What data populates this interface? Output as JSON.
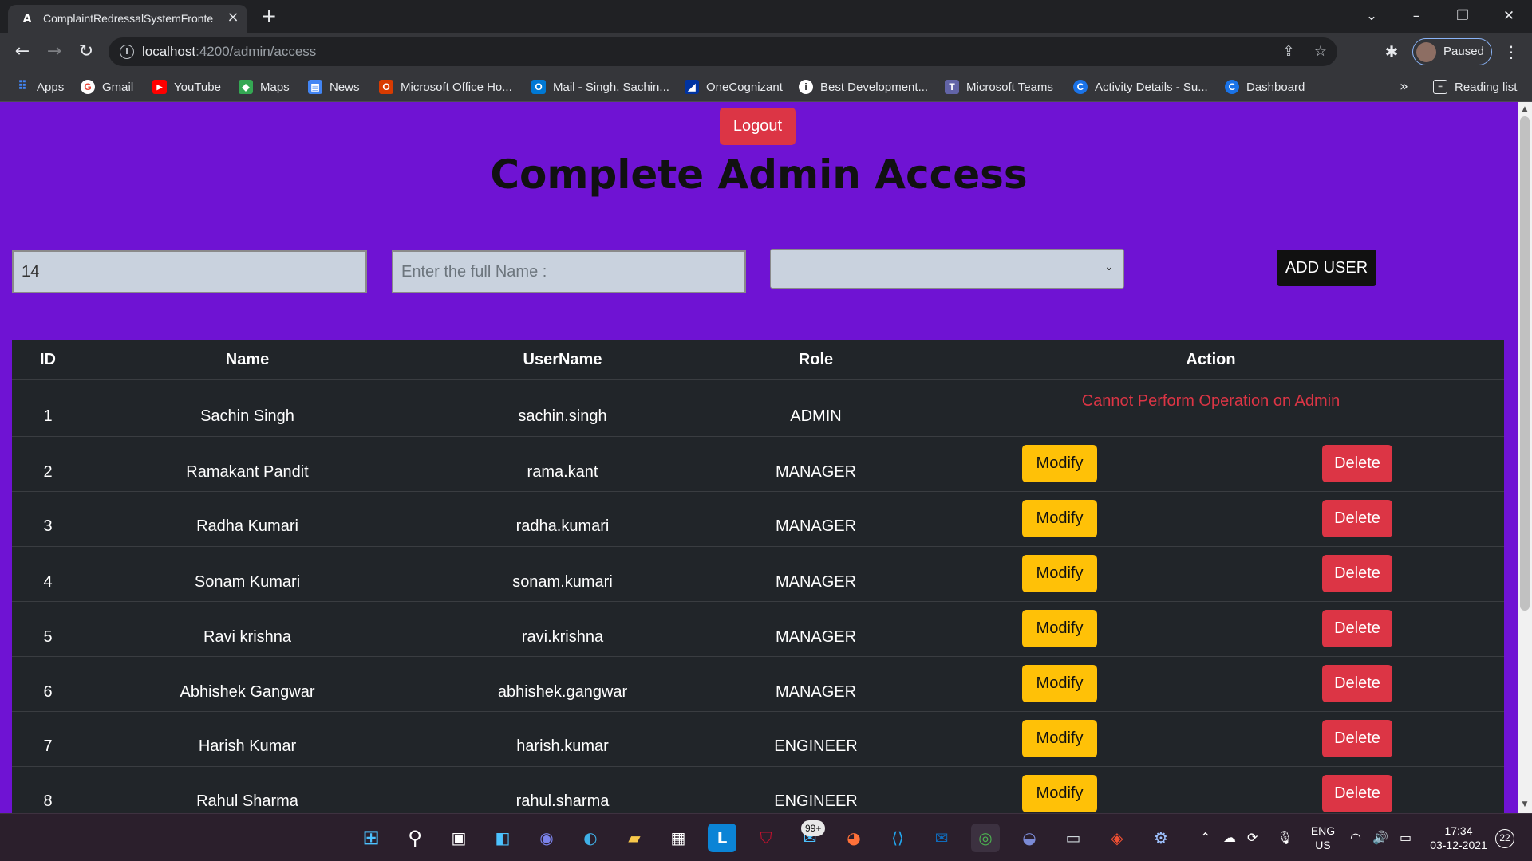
{
  "browser": {
    "tab_title": "ComplaintRedressalSystemFronte",
    "tab_favicon": "A",
    "url_host": "localhost",
    "url_path": ":4200/admin/access",
    "profile_label": "Paused"
  },
  "bookmarks": [
    {
      "label": "Apps",
      "icon": "apps-grid-icon",
      "color": "#4285f4",
      "glyph": "⋮"
    },
    {
      "label": "Gmail",
      "icon": "google-icon",
      "color": "#ffffff",
      "glyph": "G"
    },
    {
      "label": "YouTube",
      "icon": "youtube-icon",
      "color": "#ff0000",
      "glyph": "▶"
    },
    {
      "label": "Maps",
      "icon": "maps-icon",
      "color": "#34a853",
      "glyph": "◆"
    },
    {
      "label": "News",
      "icon": "news-icon",
      "color": "#4285f4",
      "glyph": "▤"
    },
    {
      "label": "Microsoft Office Ho...",
      "icon": "office-icon",
      "color": "#d83b01",
      "glyph": "O"
    },
    {
      "label": "Mail - Singh, Sachin...",
      "icon": "outlook-icon",
      "color": "#0078d4",
      "glyph": "O"
    },
    {
      "label": "OneCognizant",
      "icon": "cognizant-icon",
      "color": "#0033a1",
      "glyph": "◢"
    },
    {
      "label": "Best Development...",
      "icon": "info-circle-icon",
      "color": "#ffffff",
      "glyph": "i"
    },
    {
      "label": "Microsoft Teams",
      "icon": "teams-icon",
      "color": "#6264a7",
      "glyph": "T"
    },
    {
      "label": "Activity Details - Su...",
      "icon": "c-logo-icon",
      "color": "#1a73e8",
      "glyph": "C"
    },
    {
      "label": "Dashboard",
      "icon": "c-logo-icon",
      "color": "#1a73e8",
      "glyph": "C"
    }
  ],
  "reading_list": "Reading list",
  "page": {
    "logout_label": "Logout",
    "title": "Complete Admin Access",
    "id_field_value": "14",
    "name_field_placeholder": "Enter the full Name :",
    "role_select_value": "",
    "add_user_label": "ADD USER"
  },
  "table": {
    "headers": [
      "ID",
      "Name",
      "UserName",
      "Role",
      "Action"
    ],
    "admin_message": "Cannot Perform Operation on Admin",
    "modify_label": "Modify",
    "delete_label": "Delete",
    "rows": [
      {
        "id": "1",
        "name": "Sachin Singh",
        "username": "sachin.singh",
        "role": "ADMIN"
      },
      {
        "id": "2",
        "name": "Ramakant Pandit",
        "username": "rama.kant",
        "role": "MANAGER"
      },
      {
        "id": "3",
        "name": "Radha Kumari",
        "username": "radha.kumari",
        "role": "MANAGER"
      },
      {
        "id": "4",
        "name": "Sonam Kumari",
        "username": "sonam.kumari",
        "role": "MANAGER"
      },
      {
        "id": "5",
        "name": "Ravi krishna",
        "username": "ravi.krishna",
        "role": "MANAGER"
      },
      {
        "id": "6",
        "name": "Abhishek Gangwar",
        "username": "abhishek.gangwar",
        "role": "MANAGER"
      },
      {
        "id": "7",
        "name": "Harish Kumar",
        "username": "harish.kumar",
        "role": "ENGINEER"
      },
      {
        "id": "8",
        "name": "Rahul Sharma",
        "username": "rahul.sharma",
        "role": "ENGINEER"
      }
    ]
  },
  "taskbar": {
    "mail_badge": "99+",
    "lang_primary": "ENG",
    "lang_secondary": "US",
    "time": "17:34",
    "date": "03-12-2021",
    "notification_count": "22"
  },
  "colors": {
    "page_background": "#6f13d3",
    "danger": "#dc3545",
    "warning": "#ffc107",
    "table_background": "#212529"
  }
}
